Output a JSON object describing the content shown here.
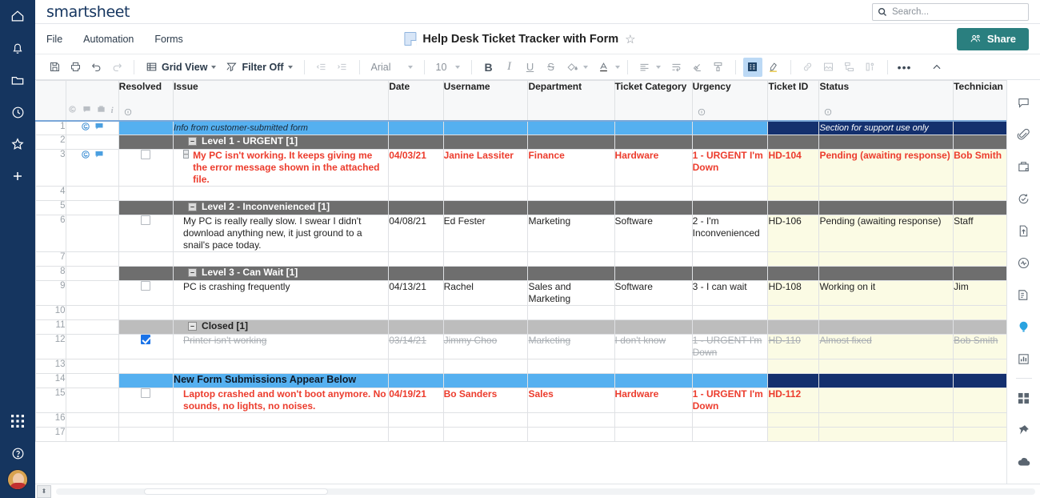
{
  "brand": {
    "logo": "smartsheet",
    "accent_teal": "#2a7f7f",
    "nav_navy": "#15355f"
  },
  "search": {
    "placeholder": "Search..."
  },
  "menubar": {
    "items": [
      "File",
      "Automation",
      "Forms"
    ],
    "title": "Help Desk Ticket Tracker with Form",
    "share_label": "Share"
  },
  "toolbar": {
    "view_label": "Grid View",
    "filter_label": "Filter Off",
    "font_name": "Arial",
    "font_size": "10",
    "bold": "B",
    "italic": "I",
    "underline": "U",
    "strikethrough": "S",
    "more": "•••"
  },
  "grid": {
    "columns": [
      {
        "label": "Resolved",
        "info": true
      },
      {
        "label": "Issue",
        "info": false
      },
      {
        "label": "Date",
        "info": false
      },
      {
        "label": "Username",
        "info": false
      },
      {
        "label": "Department",
        "info": false
      },
      {
        "label": "Ticket Category",
        "info": false
      },
      {
        "label": "Urgency",
        "info": true
      },
      {
        "label": "Ticket ID",
        "info": false
      },
      {
        "label": "Status",
        "info": true
      },
      {
        "label": "Technician",
        "info": false
      }
    ],
    "rows": [
      {
        "num": "1",
        "type": "banner",
        "note_left": "Info from customer-submitted form",
        "note_right": "Section for support use only",
        "has_attach": true,
        "has_comment": true
      },
      {
        "num": "2",
        "type": "group-dark",
        "label": "Level 1 - URGENT [1]",
        "toggle": "–"
      },
      {
        "num": "3",
        "type": "data",
        "style": "urgent",
        "checked": false,
        "has_attach": true,
        "has_comment": true,
        "marker": "–",
        "issue": "My PC isn't working. It keeps giving me the error message shown in the attached file.",
        "date": "04/03/21",
        "username": "Janine Lassiter",
        "department": "Finance",
        "category": "Hardware",
        "urgency": "1 - URGENT I'm Down",
        "ticket_id": "HD-104",
        "status": "Pending (awaiting response)",
        "technician": "Bob Smith"
      },
      {
        "num": "4",
        "type": "blank"
      },
      {
        "num": "5",
        "type": "group-dark",
        "label": "Level 2 - Inconvenienced [1]",
        "toggle": "–"
      },
      {
        "num": "6",
        "type": "data",
        "style": "normal",
        "checked": false,
        "issue": "My PC is really really slow. I swear I didn't download anything new, it just ground to a snail's pace today.",
        "date": "04/08/21",
        "username": "Ed Fester",
        "department": "Marketing",
        "category": "Software",
        "urgency": "2 - I'm Inconvenienced",
        "ticket_id": "HD-106",
        "status": "Pending (awaiting response)",
        "technician": "Staff"
      },
      {
        "num": "7",
        "type": "blank"
      },
      {
        "num": "8",
        "type": "group-dark",
        "label": "Level 3 - Can Wait [1]",
        "toggle": "–"
      },
      {
        "num": "9",
        "type": "data",
        "style": "normal",
        "checked": false,
        "issue": "PC is crashing frequently",
        "date": "04/13/21",
        "username": "Rachel",
        "department": "Sales and Marketing",
        "category": "Software",
        "urgency": "3 - I can wait",
        "ticket_id": "HD-108",
        "status": "Working on it",
        "technician": "Jim"
      },
      {
        "num": "10",
        "type": "blank"
      },
      {
        "num": "11",
        "type": "group-light",
        "label": "Closed [1]",
        "toggle": "–"
      },
      {
        "num": "12",
        "type": "data",
        "style": "closed",
        "checked": true,
        "issue": "Printer isn't working",
        "date": "03/14/21",
        "username": "Jimmy Choo",
        "department": "Marketing",
        "category": "I don't know",
        "urgency": "1 - URGENT I'm Down",
        "ticket_id": "HD-110",
        "status": "Almost fixed",
        "technician": "Bob Smith"
      },
      {
        "num": "13",
        "type": "blank"
      },
      {
        "num": "14",
        "type": "banner",
        "note_left": "New Form Submissions Appear Below",
        "note_left_bold": true,
        "note_right": "",
        "has_attach": false,
        "has_comment": false
      },
      {
        "num": "15",
        "type": "data",
        "style": "urgent",
        "checked": false,
        "issue": "Laptop crashed and won't boot anymore. No sounds, no lights, no noises.",
        "date": "04/19/21",
        "username": "Bo Sanders",
        "department": "Sales",
        "category": "Hardware",
        "urgency": "1 - URGENT I'm Down",
        "ticket_id": "HD-112",
        "status": "",
        "technician": ""
      },
      {
        "num": "16",
        "type": "blank"
      },
      {
        "num": "17",
        "type": "blank"
      }
    ]
  },
  "left_nav": {
    "items": [
      "home-icon",
      "bell-icon",
      "folder-icon",
      "clock-icon",
      "star-icon",
      "plus-icon"
    ],
    "bottom": [
      "grid-apps-icon",
      "help-icon",
      "avatar"
    ]
  },
  "right_rail": {
    "items": [
      "comment-icon",
      "attachment-icon",
      "proof-icon",
      "update-request-icon",
      "publish-icon",
      "activity-log-icon",
      "summary-icon",
      "balloon-icon",
      "chart-icon",
      "apps-icon",
      "pin-icon",
      "cloud-icon"
    ]
  }
}
